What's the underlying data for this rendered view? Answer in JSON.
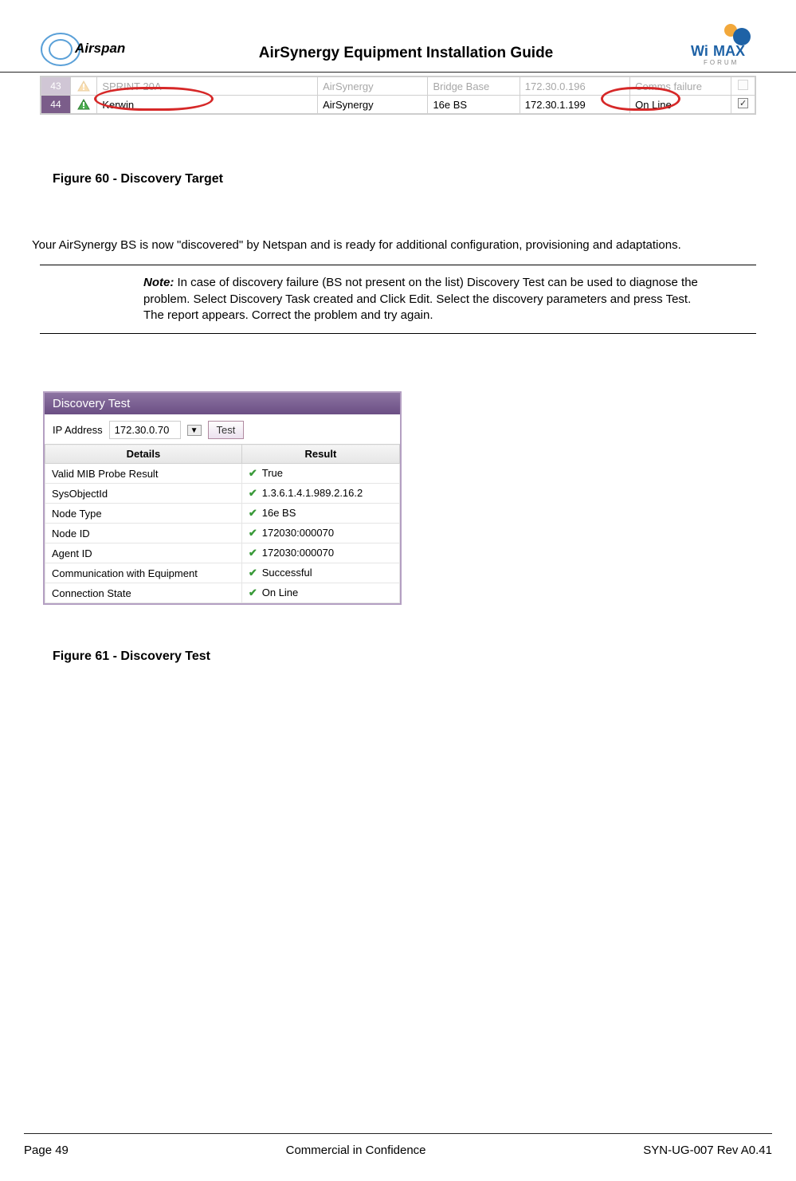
{
  "header": {
    "doc_title": "AirSynergy Equipment Installation Guide"
  },
  "screenshot1": {
    "rows": [
      {
        "idx": "43",
        "name": "SPRINT 20A",
        "product": "AirSynergy",
        "mode": "Bridge Base",
        "ip": "172.30.0.196",
        "status": "Comms failure",
        "checked": false
      },
      {
        "idx": "44",
        "name": "Kerwin",
        "product": "AirSynergy",
        "mode": "16e BS",
        "ip": "172.30.1.199",
        "status": "On Line",
        "checked": true
      }
    ]
  },
  "figure60": "Figure 60 - Discovery Target",
  "paragraph": "Your AirSynergy BS is now \"discovered\" by Netspan and is ready for additional configuration, provisioning and adaptations.",
  "note": {
    "label": "Note:",
    "text": " In case of discovery failure (BS not present on the list) Discovery Test can be used to diagnose the problem. Select Discovery Task created and Click Edit. Select the discovery parameters and press Test. The report appears. Correct the problem and try again."
  },
  "discovery_test": {
    "title": "Discovery Test",
    "ip_label": "IP Address",
    "ip_value": "172.30.0.70",
    "test_btn": "Test",
    "headers": {
      "details": "Details",
      "result": "Result"
    },
    "rows": [
      {
        "detail": "Valid MIB Probe Result",
        "result": "True"
      },
      {
        "detail": "SysObjectId",
        "result": "1.3.6.1.4.1.989.2.16.2"
      },
      {
        "detail": "Node Type",
        "result": "16e BS"
      },
      {
        "detail": "Node ID",
        "result": "172030:000070"
      },
      {
        "detail": "Agent ID",
        "result": "172030:000070"
      },
      {
        "detail": "Communication with Equipment",
        "result": "Successful"
      },
      {
        "detail": "Connection State",
        "result": "On Line"
      }
    ]
  },
  "figure61": "Figure 61 - Discovery Test",
  "footer": {
    "page": "Page 49",
    "confidential": "Commercial in Confidence",
    "docrev": "SYN-UG-007 Rev A0.41"
  }
}
